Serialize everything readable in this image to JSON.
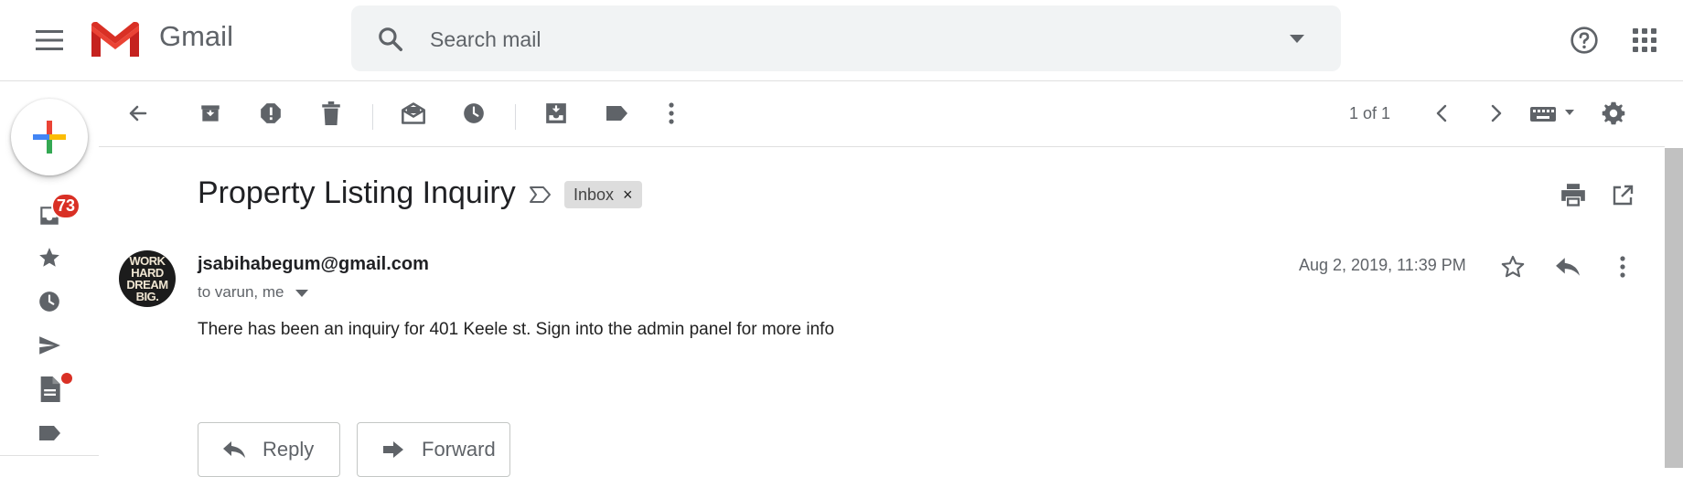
{
  "app": {
    "brand": "Gmail"
  },
  "colors": {
    "accent_red": "#d93025",
    "icon_gray": "#5f6368",
    "label_bg": "#dddddd"
  },
  "search": {
    "placeholder": "Search mail"
  },
  "header_icons": [
    "menu-icon",
    "gmail-logo",
    "search-icon",
    "dropdown-arrow-icon",
    "help-icon",
    "apps-grid-icon"
  ],
  "rail": {
    "compose_icon": "plus-icon",
    "inbox_badge": "73",
    "items": [
      "inbox-icon",
      "star-icon",
      "clock-icon",
      "send-icon",
      "draft-icon",
      "label-icon"
    ]
  },
  "toolbar": {
    "icons": [
      "back-arrow-icon",
      "archive-icon",
      "report-spam-icon",
      "delete-icon",
      "mark-unread-icon",
      "snooze-icon",
      "move-to-icon",
      "label-icon",
      "more-vert-icon",
      "chevron-left-icon",
      "chevron-right-icon",
      "keyboard-icon",
      "settings-icon"
    ],
    "pager": "1 of 1"
  },
  "message": {
    "subject": "Property Listing Inquiry",
    "label": "Inbox",
    "label_remove": "×",
    "avatar_text": "WORK HARD DREAM BIG.",
    "sender": "jsabihabegum@gmail.com",
    "recipients": "to varun, me",
    "date": "Aug 2, 2019, 11:39 PM",
    "body": "There has been an inquiry for 401 Keele st. Sign into the admin panel for more info"
  },
  "actions": {
    "reply_label": "Reply",
    "forward_label": "Forward"
  }
}
